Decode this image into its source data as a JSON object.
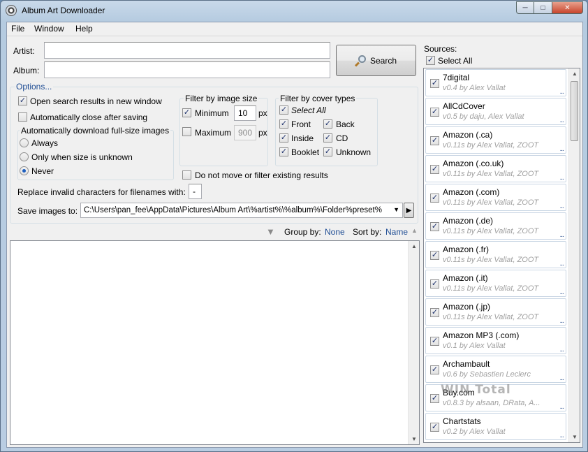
{
  "window": {
    "title": "Album Art Downloader"
  },
  "menu": [
    "File",
    "Window",
    "Help"
  ],
  "search": {
    "artist_label": "Artist:",
    "artist_value": "",
    "album_label": "Album:",
    "album_value": "",
    "search_button": "Search"
  },
  "options": {
    "title": "Options...",
    "open_new_window": "Open search results in new window",
    "auto_close": "Automatically close after saving",
    "auto_download_label": "Automatically download full-size images",
    "radio_always": "Always",
    "radio_unknown": "Only when size is unknown",
    "radio_never": "Never",
    "filter_size_title": "Filter by image size",
    "minimum_label": "Minimum",
    "minimum_value": "10",
    "maximum_label": "Maximum",
    "maximum_value": "900",
    "px": "px",
    "filter_cover_title": "Filter by cover types",
    "select_all": "Select All",
    "front": "Front",
    "back": "Back",
    "inside": "Inside",
    "cd": "CD",
    "booklet": "Booklet",
    "unknown": "Unknown",
    "no_move": "Do not move or filter existing results",
    "replace_label": "Replace invalid characters for filenames with:",
    "replace_value": "-",
    "save_label": "Save images to:",
    "save_value": "C:\\Users\\pan_fee\\AppData\\Pictures\\Album Art\\%artist%\\%album%\\Folder%preset%"
  },
  "results_bar": {
    "group_by_label": "Group by:",
    "group_by_value": "None",
    "sort_by_label": "Sort by:",
    "sort_by_value": "Name"
  },
  "sources": {
    "label": "Sources:",
    "select_all": "Select All",
    "items": [
      {
        "name": "7digital",
        "version": "v0.4 by Alex Vallat"
      },
      {
        "name": "AllCdCover",
        "version": "v0.5 by daju, Alex Vallat"
      },
      {
        "name": "Amazon (.ca)",
        "version": "v0.11s by Alex Vallat, ZOOT"
      },
      {
        "name": "Amazon (.co.uk)",
        "version": "v0.11s by Alex Vallat, ZOOT"
      },
      {
        "name": "Amazon (.com)",
        "version": "v0.11s by Alex Vallat, ZOOT"
      },
      {
        "name": "Amazon (.de)",
        "version": "v0.11s by Alex Vallat, ZOOT"
      },
      {
        "name": "Amazon (.fr)",
        "version": "v0.11s by Alex Vallat, ZOOT"
      },
      {
        "name": "Amazon (.it)",
        "version": "v0.11s by Alex Vallat, ZOOT"
      },
      {
        "name": "Amazon (.jp)",
        "version": "v0.11s by Alex Vallat, ZOOT"
      },
      {
        "name": "Amazon MP3 (.com)",
        "version": "v0.1 by Alex Vallat"
      },
      {
        "name": "Archambault",
        "version": "v0.6 by Sebastien Leclerc"
      },
      {
        "name": "Buy.com",
        "version": "v0.8.3 by alsaan, DRata, A..."
      },
      {
        "name": "Chartstats",
        "version": "v0.2 by Alex Vallat"
      }
    ],
    "more": "..."
  },
  "watermark": "WIN Total"
}
